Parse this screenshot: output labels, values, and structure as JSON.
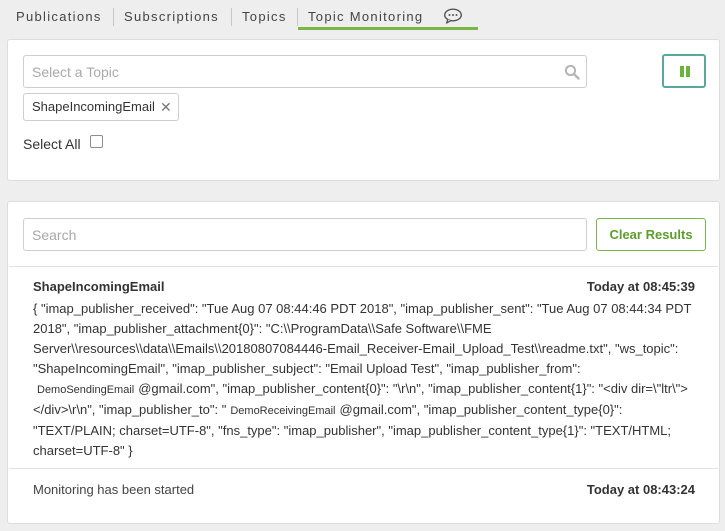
{
  "tabs": [
    {
      "label": "Publications"
    },
    {
      "label": "Subscriptions"
    },
    {
      "label": "Topics"
    },
    {
      "label": "Topic Monitoring",
      "active": true
    }
  ],
  "colors": {
    "accent": "#7ab648",
    "pause_border": "#5aa7a0",
    "pause_icon": "#6bb33a"
  },
  "topic_select": {
    "placeholder": "Select a Topic",
    "value": ""
  },
  "selected_topics": [
    {
      "label": "ShapeIncomingEmail"
    }
  ],
  "select_all": {
    "label": "Select All",
    "checked": false
  },
  "results_search": {
    "placeholder": "Search",
    "value": ""
  },
  "clear_results_label": "Clear Results",
  "messages": [
    {
      "topic": "ShapeIncomingEmail",
      "time": "Today at 08:45:39",
      "body_part1": "{ \"imap_publisher_received\": \"Tue Aug 07 08:44:46 PDT 2018\", \"imap_publisher_sent\": \"Tue Aug 07 08:44:34 PDT 2018\", \"imap_publisher_attachment{0}\": \"C:\\\\ProgramData\\\\Safe Software\\\\FME Server\\\\resources\\\\data\\\\Emails\\\\20180807084446-Email_Receiver-Email_Upload_Test\\\\readme.txt\", \"ws_topic\": \"ShapeIncomingEmail\", \"imap_publisher_subject\": \"Email Upload Test\", \"imap_publisher_from\": ",
      "sender_name": "DemoSendingEmail",
      "body_part2": "@gmail.com\", \"imap_publisher_content{0}\": \"\\r\\n\", \"imap_publisher_content{1}\": \"<div dir=\\\"ltr\\\"></div>\\r\\n\", \"imap_publisher_to\": \"",
      "receiver_name": "DemoReceivingEmail",
      "body_part3": "@gmail.com\", \"imap_publisher_content_type{0}\": \"TEXT/PLAIN; charset=UTF-8\", \"fns_type\": \"imap_publisher\", \"imap_publisher_content_type{1}\": \"TEXT/HTML; charset=UTF-8\" }"
    }
  ],
  "status": {
    "text": "Monitoring has been started",
    "time": "Today at 08:43:24"
  }
}
